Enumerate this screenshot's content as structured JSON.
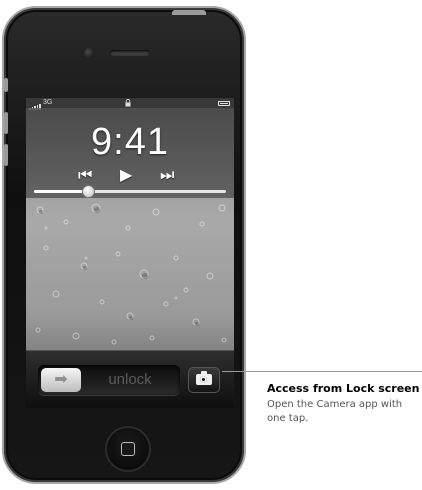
{
  "status_bar": {
    "network": "3G",
    "signal_icon": "signal-bars-icon",
    "lock_icon": "padlock-icon",
    "battery_icon": "battery-icon"
  },
  "lock_screen": {
    "time": "9:41",
    "media_controls": {
      "prev": "⏮",
      "play": "▶",
      "next": "⏭"
    },
    "playback_progress": 0.28,
    "slider_text": "unlock",
    "slider_arrow": "➡",
    "camera_icon": "camera-icon"
  },
  "callout": {
    "title": "Access from Lock screen",
    "body": "Open the Camera app with one tap."
  },
  "colors": {
    "phone_body": "#111111",
    "callout_line": "#9a9a9a",
    "callout_body_text": "#555555"
  }
}
